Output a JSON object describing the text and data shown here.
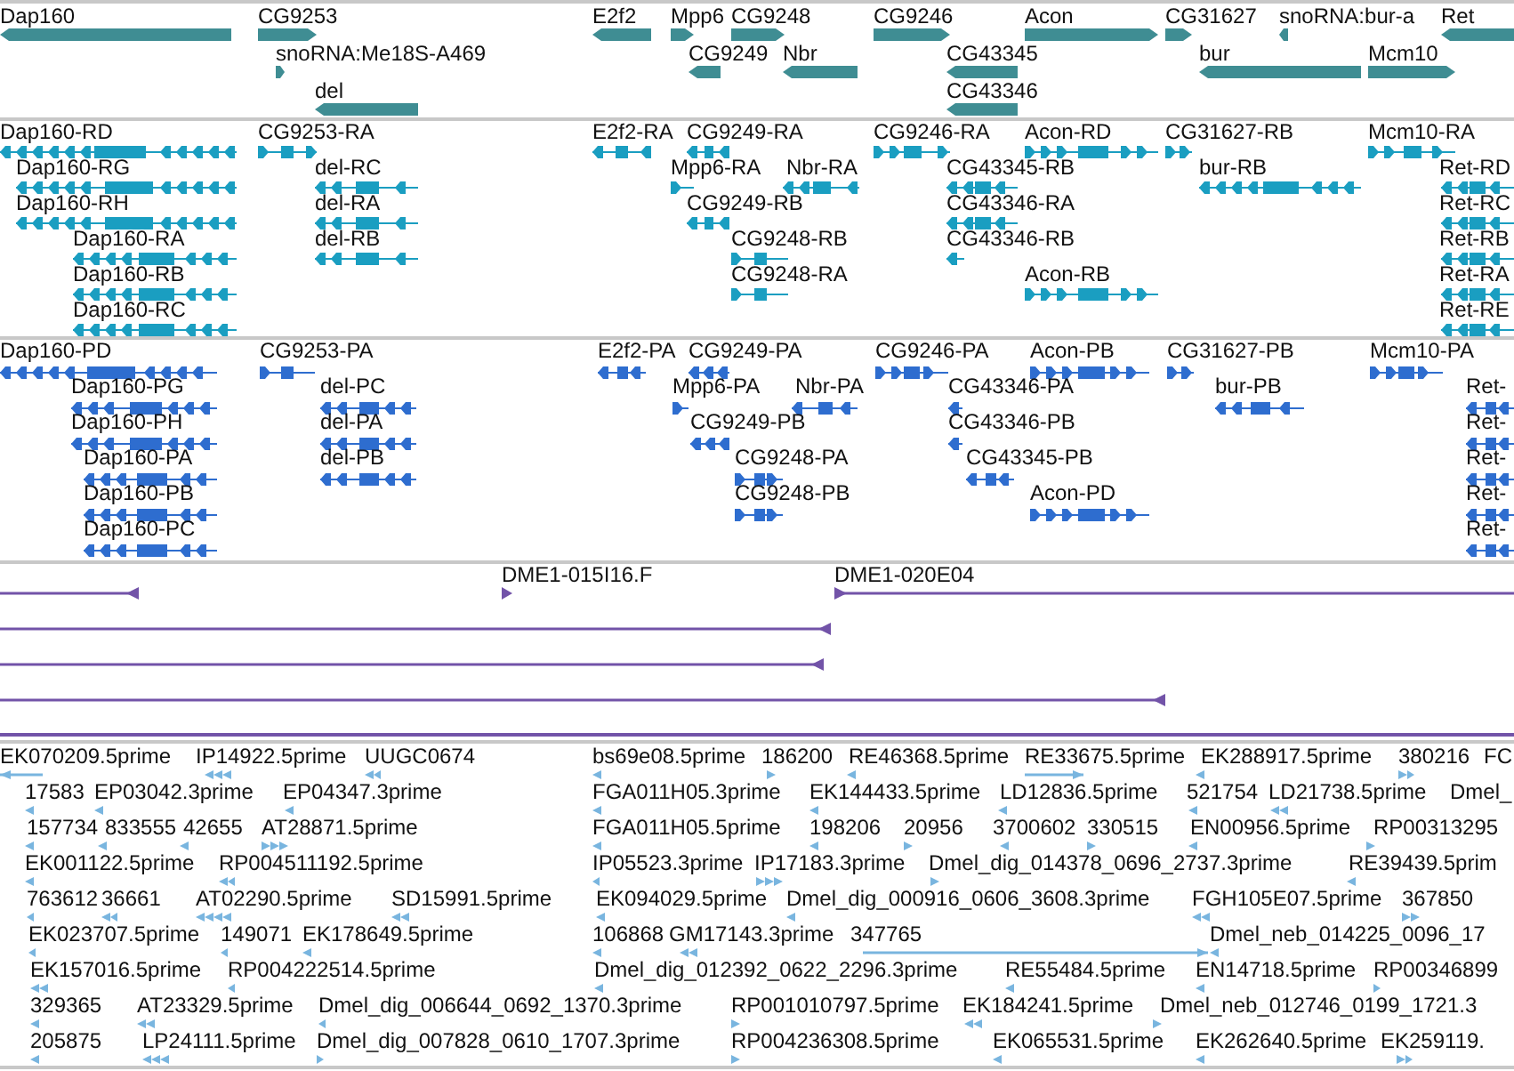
{
  "tracks": [
    {
      "kind": "gene",
      "features": [
        {
          "label": "Dap160",
          "reverse": true
        },
        {
          "label": "CG9253",
          "reverse": false
        },
        {
          "label": "E2f2",
          "reverse": true
        },
        {
          "label": "Mpp6",
          "reverse": false
        },
        {
          "label": "CG9248",
          "reverse": false
        },
        {
          "label": "CG9246",
          "reverse": false
        },
        {
          "label": "Acon",
          "reverse": false
        },
        {
          "label": "CG31627",
          "reverse": false
        },
        {
          "label": "snoRNA:bur-a",
          "reverse": true
        },
        {
          "label": "Ret",
          "reverse": true
        },
        {
          "label": "snoRNA:Me18S-A469",
          "reverse": false
        },
        {
          "label": "CG9249",
          "reverse": true
        },
        {
          "label": "Nbr",
          "reverse": true
        },
        {
          "label": "CG43345",
          "reverse": true
        },
        {
          "label": "bur",
          "reverse": true
        },
        {
          "label": "Mcm10",
          "reverse": false
        },
        {
          "label": "del",
          "reverse": true
        },
        {
          "label": "CG43346",
          "reverse": true
        }
      ]
    },
    {
      "kind": "transcript",
      "features": [
        {
          "label": "Dap160-RD",
          "reverse": true
        },
        {
          "label": "CG9253-RA",
          "reverse": false
        },
        {
          "label": "E2f2-RA",
          "reverse": true
        },
        {
          "label": "CG9249-RA",
          "reverse": true
        },
        {
          "label": "CG9246-RA",
          "reverse": false
        },
        {
          "label": "Acon-RD",
          "reverse": false
        },
        {
          "label": "CG31627-RB",
          "reverse": false
        },
        {
          "label": "Mcm10-RA",
          "reverse": false
        },
        {
          "label": "Dap160-RG",
          "reverse": true
        },
        {
          "label": "del-RC",
          "reverse": true
        },
        {
          "label": "Mpp6-RA",
          "reverse": false
        },
        {
          "label": "Nbr-RA",
          "reverse": true
        },
        {
          "label": "CG43345-RB",
          "reverse": true
        },
        {
          "label": "bur-RB",
          "reverse": true
        },
        {
          "label": "Ret-RD",
          "reverse": true
        },
        {
          "label": "Dap160-RH",
          "reverse": true
        },
        {
          "label": "del-RA",
          "reverse": true
        },
        {
          "label": "CG9249-RB",
          "reverse": true
        },
        {
          "label": "CG43346-RA",
          "reverse": true
        },
        {
          "label": "Ret-RC",
          "reverse": true
        },
        {
          "label": "Dap160-RA",
          "reverse": true
        },
        {
          "label": "del-RB",
          "reverse": true
        },
        {
          "label": "CG9248-RB",
          "reverse": false
        },
        {
          "label": "CG43346-RB",
          "reverse": true
        },
        {
          "label": "Ret-RB",
          "reverse": true
        },
        {
          "label": "Dap160-RB",
          "reverse": true
        },
        {
          "label": "CG9248-RA",
          "reverse": false
        },
        {
          "label": "Acon-RB",
          "reverse": false
        },
        {
          "label": "Ret-RA",
          "reverse": true
        },
        {
          "label": "Dap160-RC",
          "reverse": true
        },
        {
          "label": "Ret-RE",
          "reverse": true
        }
      ]
    },
    {
      "kind": "protein",
      "features": [
        {
          "label": "Dap160-PD",
          "reverse": true
        },
        {
          "label": "CG9253-PA",
          "reverse": false
        },
        {
          "label": "E2f2-PA",
          "reverse": true
        },
        {
          "label": "CG9249-PA",
          "reverse": true
        },
        {
          "label": "CG9246-PA",
          "reverse": false
        },
        {
          "label": "Acon-PB",
          "reverse": false
        },
        {
          "label": "CG31627-PB",
          "reverse": false
        },
        {
          "label": "Mcm10-PA",
          "reverse": false
        },
        {
          "label": "Dap160-PG",
          "reverse": true
        },
        {
          "label": "del-PC",
          "reverse": true
        },
        {
          "label": "Mpp6-PA",
          "reverse": false
        },
        {
          "label": "Nbr-PA",
          "reverse": true
        },
        {
          "label": "CG43346-PA",
          "reverse": true
        },
        {
          "label": "bur-PB",
          "reverse": true
        },
        {
          "label": "Ret-",
          "reverse": true
        },
        {
          "label": "Dap160-PH",
          "reverse": true
        },
        {
          "label": "del-PA",
          "reverse": true
        },
        {
          "label": "CG9249-PB",
          "reverse": true
        },
        {
          "label": "CG43346-PB",
          "reverse": true
        },
        {
          "label": "Ret-",
          "reverse": true
        },
        {
          "label": "Dap160-PA",
          "reverse": true
        },
        {
          "label": "del-PB",
          "reverse": true
        },
        {
          "label": "CG9248-PA",
          "reverse": false
        },
        {
          "label": "CG43345-PB",
          "reverse": true
        },
        {
          "label": "Ret-",
          "reverse": true
        },
        {
          "label": "Dap160-PB",
          "reverse": true
        },
        {
          "label": "CG9248-PB",
          "reverse": false
        },
        {
          "label": "Acon-PD",
          "reverse": false
        },
        {
          "label": "Ret-",
          "reverse": true
        },
        {
          "label": "Dap160-PC",
          "reverse": true
        },
        {
          "label": "Ret-",
          "reverse": true
        }
      ]
    },
    {
      "kind": "clone",
      "features": [
        {
          "reverse": true
        },
        {
          "label": "DME1-015I16.F",
          "reverse": false
        },
        {
          "label": "DME1-020E04",
          "reverse": false
        },
        {
          "reverse": true
        },
        {
          "reverse": true
        },
        {
          "reverse": true
        }
      ]
    },
    {
      "kind": "est",
      "features": [
        {
          "label": "EK070209.5prime",
          "reverse": true
        },
        {
          "label": "IP14922.5prime",
          "reverse": true
        },
        {
          "label": "UUGC0674",
          "reverse": true
        },
        {
          "label": "bs69e08.5prime",
          "reverse": true
        },
        {
          "label": "186200",
          "reverse": false
        },
        {
          "label": "RE46368.5prime",
          "reverse": true
        },
        {
          "label": "RE33675.5prime",
          "reverse": false
        },
        {
          "label": "EK288917.5prime",
          "reverse": true
        },
        {
          "label": "380216",
          "reverse": false
        },
        {
          "label": "FC"
        },
        {
          "label": "17583",
          "reverse": true
        },
        {
          "label": "EP03042.3prime",
          "reverse": true
        },
        {
          "label": "EP04347.3prime",
          "reverse": true
        },
        {
          "label": "FGA011H05.3prime",
          "reverse": true
        },
        {
          "label": "EK144433.5prime",
          "reverse": true
        },
        {
          "label": "LD12836.5prime",
          "reverse": true
        },
        {
          "label": "521754",
          "reverse": true
        },
        {
          "label": "LD21738.5prime",
          "reverse": true
        },
        {
          "label": "Dmel_"
        },
        {
          "label": "157734",
          "reverse": true
        },
        {
          "label": "833555",
          "reverse": true
        },
        {
          "label": "42655",
          "reverse": true
        },
        {
          "label": "AT28871.5prime",
          "reverse": false
        },
        {
          "label": "FGA011H05.5prime",
          "reverse": true
        },
        {
          "label": "198206",
          "reverse": true
        },
        {
          "label": "20956",
          "reverse": false
        },
        {
          "label": "3700602",
          "reverse": true
        },
        {
          "label": "330515",
          "reverse": false
        },
        {
          "label": "EN00956.5prime",
          "reverse": true
        },
        {
          "label": "RP00313295",
          "reverse": false
        },
        {
          "label": "EK001122.5prime",
          "reverse": true
        },
        {
          "label": "RP004511192.5prime",
          "reverse": true
        },
        {
          "label": "IP05523.3prime",
          "reverse": true
        },
        {
          "label": "IP17183.3prime",
          "reverse": false
        },
        {
          "label": "Dmel_dig_014378_0696_2737.3prime",
          "reverse": false
        },
        {
          "label": "RE39439.5prim",
          "reverse": true
        },
        {
          "label": "763612",
          "reverse": true
        },
        {
          "label": "36661",
          "reverse": true
        },
        {
          "label": "AT02290.5prime",
          "reverse": true
        },
        {
          "label": "SD15991.5prime",
          "reverse": true
        },
        {
          "label": "EK094029.5prime",
          "reverse": true
        },
        {
          "label": "Dmel_dig_000916_0606_3608.3prime",
          "reverse": true
        },
        {
          "label": "FGH105E07.5prime",
          "reverse": true
        },
        {
          "label": "367850",
          "reverse": false
        },
        {
          "label": "EK023707.5prime",
          "reverse": true
        },
        {
          "label": "149071",
          "reverse": true
        },
        {
          "label": "EK178649.5prime",
          "reverse": true
        },
        {
          "label": "106868",
          "reverse": true
        },
        {
          "label": "GM17143.3prime",
          "reverse": true
        },
        {
          "label": "347765",
          "reverse": false
        },
        {
          "label": "Dmel_neb_014225_0096_17",
          "reverse": true
        },
        {
          "label": "EK157016.5prime",
          "reverse": true
        },
        {
          "label": "RP004222514.5prime",
          "reverse": true
        },
        {
          "label": "Dmel_dig_012392_0622_2296.3prime",
          "reverse": true
        },
        {
          "label": "RE55484.5prime",
          "reverse": true
        },
        {
          "label": "EN14718.5prime",
          "reverse": true
        },
        {
          "label": "RP00346899",
          "reverse": false
        },
        {
          "label": "329365",
          "reverse": true
        },
        {
          "label": "AT23329.5prime",
          "reverse": true
        },
        {
          "label": "Dmel_dig_006644_0692_1370.3prime",
          "reverse": true
        },
        {
          "label": "RP001010797.5prime",
          "reverse": false
        },
        {
          "label": "EK184241.5prime",
          "reverse": true
        },
        {
          "label": "Dmel_neb_012746_0199_1721.3",
          "reverse": false
        },
        {
          "label": "205875",
          "reverse": true
        },
        {
          "label": "LP24111.5prime",
          "reverse": true
        },
        {
          "label": "Dmel_dig_007828_0610_1707.3prime",
          "reverse": false
        },
        {
          "label": "RP004236308.5prime",
          "reverse": false
        },
        {
          "label": "EK065531.5prime",
          "reverse": true
        },
        {
          "label": "EK262640.5prime",
          "reverse": true
        },
        {
          "label": "EK259119.",
          "reverse": false
        }
      ]
    }
  ]
}
